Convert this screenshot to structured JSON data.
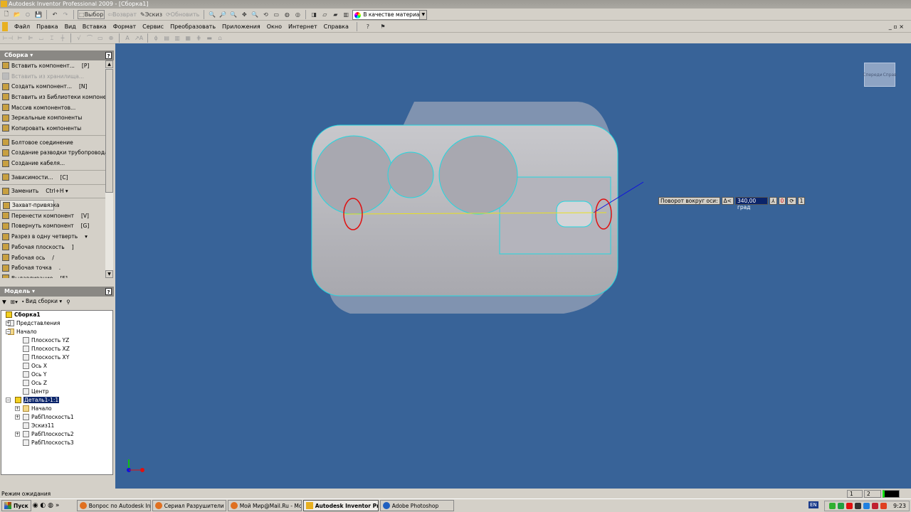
{
  "window": {
    "title": "Autodesk Inventor Professional 2009 - [Сборка1]"
  },
  "toolbar": {
    "select": "Выбор",
    "return": "Возврат",
    "sketch": "Эскиз",
    "update": "Обновить",
    "appearance": "В качестве материала"
  },
  "menu": [
    "Файл",
    "Правка",
    "Вид",
    "Вставка",
    "Формат",
    "Сервис",
    "Преобразовать",
    "Приложения",
    "Окно",
    "Интернет",
    "Справка"
  ],
  "assembly_panel": {
    "title": "Сборка ▾",
    "items": [
      {
        "label": "Вставить компонент...",
        "shortcut": "[P]"
      },
      {
        "label": "Вставить из хранилища...",
        "shortcut": "",
        "disabled": true
      },
      {
        "label": "Создать компонент...",
        "shortcut": "[N]"
      },
      {
        "label": "Вставить из Библиотеки компонентов.",
        "shortcut": ""
      },
      {
        "label": "Массив компонентов...",
        "shortcut": ""
      },
      {
        "label": "Зеркальные компоненты",
        "shortcut": ""
      },
      {
        "label": "Копировать компоненты",
        "shortcut": ""
      },
      {
        "label": "Болтовое соединение",
        "shortcut": ""
      },
      {
        "label": "Создание разводки трубопровода...",
        "shortcut": ""
      },
      {
        "label": "Создание кабеля...",
        "shortcut": ""
      },
      {
        "label": "Зависимости...",
        "shortcut": "[C]"
      },
      {
        "label": "Заменить",
        "shortcut": "Ctrl+H ▾"
      },
      {
        "label": "Захват-привязка",
        "shortcut": ""
      },
      {
        "label": "Перенести компонент",
        "shortcut": "[V]"
      },
      {
        "label": "Повернуть компонент",
        "shortcut": "[G]"
      },
      {
        "label": "Разрез в одну четверть",
        "shortcut": "▾"
      },
      {
        "label": "Рабочая плоскость",
        "shortcut": "]"
      },
      {
        "label": "Рабочая ось",
        "shortcut": "/"
      },
      {
        "label": "Рабочая точка",
        "shortcut": "."
      },
      {
        "label": "Выдавливание",
        "shortcut": "[E]"
      }
    ]
  },
  "model_panel": {
    "title": "Модель ▾",
    "view": "Вид сборки",
    "tree": [
      {
        "label": "Сборка1"
      },
      {
        "label": "Представления"
      },
      {
        "label": "Начало"
      },
      {
        "label": "Плоскость YZ"
      },
      {
        "label": "Плоскость XZ"
      },
      {
        "label": "Плоскость XY"
      },
      {
        "label": "Ось X"
      },
      {
        "label": "Ось Y"
      },
      {
        "label": "Ось Z"
      },
      {
        "label": "Центр"
      },
      {
        "label": "Деталь1-1:1"
      },
      {
        "label": "Начало"
      },
      {
        "label": "РабПлоскость1"
      },
      {
        "label": "Эскиз11"
      },
      {
        "label": "РабПлоскость2"
      },
      {
        "label": "РабПлоскость3"
      }
    ]
  },
  "viewcube": {
    "front": "Спереди",
    "right": "Справ"
  },
  "rotate_tool": {
    "label": "Поворот вокруг оси:",
    "delta": "Δ<",
    "value": "340,00 град",
    "zero": "0",
    "one": "1"
  },
  "status": {
    "text": "Режим ожидания",
    "box1": "1",
    "box2": "2"
  },
  "taskbar": {
    "start": "Пуск",
    "tasks": [
      "Вопрос по Autodesk Inv...",
      "Сериал Разрушители л...",
      "Мой Мир@Mail.Ru - Mozi...",
      "Autodesk Inventor Pr...",
      "Adobe Photoshop"
    ],
    "lang": "EN",
    "clock": "9:23"
  }
}
